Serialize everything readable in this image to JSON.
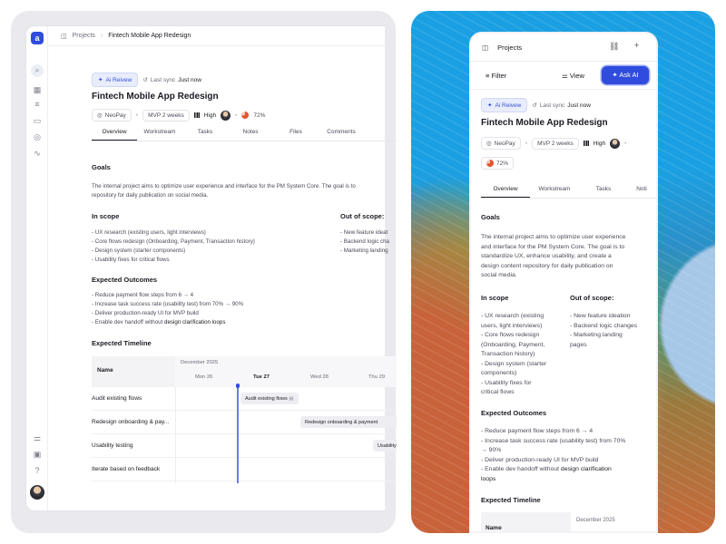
{
  "desktop": {
    "breadcrumb": {
      "root": "Projects",
      "current": "Fintech Mobile App Redesign"
    },
    "ai_chip": "Ai Reivew",
    "sync_label": "Last sync",
    "sync_value": "Just now",
    "title": "Fintech Mobile App Redesign",
    "meta": {
      "owner": "NeoPay",
      "milestone": "MVP 2 weeks",
      "priority": "High",
      "progress": "72%"
    },
    "tabs": [
      "Overview",
      "Workstream",
      "Tasks",
      "Notes",
      "Files",
      "Comments"
    ],
    "goals": {
      "heading": "Goals",
      "line1": "The internal project aims to optimize user experience and interface for the PM System Core. The goal is to",
      "line2": "repository for daily publication on social media."
    },
    "in_scope": {
      "heading": "In scope",
      "items": [
        "- UX research (existing users, light interviews)",
        "- Core flows redesign (Onboarding, Payment, Transaction history)",
        "- Design system (starter components)",
        "- Usability fixes for critical flows"
      ]
    },
    "out_scope": {
      "heading": "Out of scope:",
      "items": [
        "- New feature ideat",
        "- Backend logic cha",
        "- Marketing landing"
      ]
    },
    "outcomes": {
      "heading": "Expected Outcomes",
      "items": [
        "- Reduce payment flow steps from 6 → 4",
        "- Increase task success rate (usability test) from 70% → 90%",
        "- Deliver production-ready UI for MVP build"
      ],
      "last_prefix": "- Enable dev handoff without ",
      "last_bold": "design clarification loops"
    },
    "timeline": {
      "heading": "Expected Timeline",
      "name_col": "Name",
      "month": "December 2025",
      "days": [
        "Mon 26",
        "Tue 27",
        "Wed 28",
        "Thu 29"
      ],
      "rows": [
        {
          "label": "Audit existing flows",
          "bar": "Audit existing flows"
        },
        {
          "label": "Redesign onboarding & pay...",
          "bar": "Redesign onboarding & payment"
        },
        {
          "label": "Usability testing",
          "bar": "Usability"
        },
        {
          "label": "Iterate based on feedback",
          "bar": ""
        }
      ]
    }
  },
  "mobile": {
    "project": "Projects",
    "filter": "Filter",
    "view": "View",
    "ask_ai": "✦ Ask AI",
    "ai_chip": "Ai Reivew",
    "sync_label": "Last sync",
    "sync_value": "Just now",
    "title": "Fintech Mobile App Redesign",
    "meta": {
      "owner": "NeoPay",
      "milestone": "MVP 2 weeks",
      "priority": "High",
      "progress": "72%"
    },
    "tabs": [
      "Overview",
      "Workstream",
      "Tasks",
      "Noti"
    ],
    "goals": {
      "heading": "Goals",
      "lines": [
        "The internal project aims to optimize user experience",
        "and interface for the PM System Core. The goal is to",
        "standardize UX, enhance usability, and create a",
        "design content repository for daily publication on",
        "social media."
      ]
    },
    "in_scope": {
      "heading": "In scope",
      "lines": [
        "- UX research (existing",
        "users, light interviews)",
        "- Core flows redesign",
        "(Onboarding, Payment,",
        "Transaction history)",
        "- Design system (starter",
        "components)",
        "- Usability fixes for",
        "critical flows"
      ]
    },
    "out_scope": {
      "heading": "Out of scope:",
      "lines": [
        "- New feature ideation",
        "- Backend logic changes",
        "- Marketing landing",
        "pages"
      ]
    },
    "outcomes": {
      "heading": "Expected Outcomes",
      "lines": [
        "- Reduce payment flow steps from 6 → 4",
        "- Increase task success rate (usability test) from 70%",
        "→ 90%",
        "- Deliver production-ready UI for MVP build"
      ],
      "last_prefix": "- Enable dev handoff without ",
      "last_bold": "design clarification",
      "last_bold2": "loops"
    },
    "timeline": {
      "heading": "Expected Timeline",
      "name_col": "Name",
      "month": "December 2025"
    }
  },
  "colors": {
    "accent": "#2f4cdd",
    "progress": "#e3552d"
  }
}
